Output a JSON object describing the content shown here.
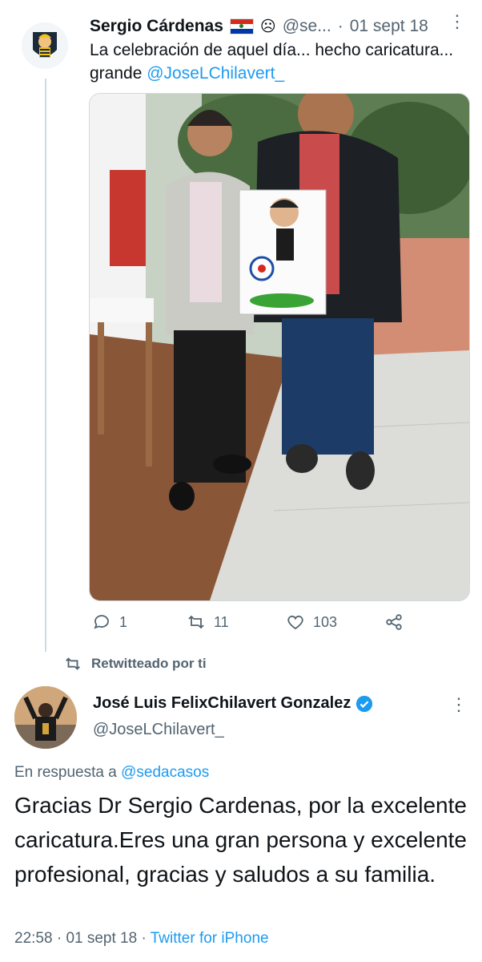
{
  "tweet1": {
    "author_name": "Sergio Cárdenas",
    "handle": "@se...",
    "separator": "·",
    "date": "01 sept 18",
    "text_plain": "La celebración de aquel día... hecho caricatura... grande ",
    "mention": "@JoseLChilavert_",
    "stats": {
      "replies": "1",
      "retweets": "11",
      "likes": "103"
    },
    "icons": [
      "paraguay-flag-icon",
      "profile-badge-icon",
      "reply-icon",
      "retweet-icon",
      "like-icon",
      "share-icon",
      "more-icon"
    ]
  },
  "retweet_banner": {
    "label": "Retwitteado por ti"
  },
  "tweet2": {
    "author_name": "José Luis FelixChilavert Gonzalez",
    "handle": "@JoseLChilavert_",
    "reply_prefix": "En respuesta a ",
    "reply_to": "@sedacasos",
    "text": "Gracias Dr Sergio Cardenas, por la excelente caricatura.Eres una gran persona y excelente profesional, gracias y saludos a su familia.",
    "time": "22:58",
    "separator1": "·",
    "date": "01 sept 18",
    "separator2": "·",
    "source": "Twitter for iPhone"
  },
  "colors": {
    "link": "#1d9bf0",
    "muted": "#536471",
    "text": "#0f1419",
    "line": "#cfd9de"
  }
}
